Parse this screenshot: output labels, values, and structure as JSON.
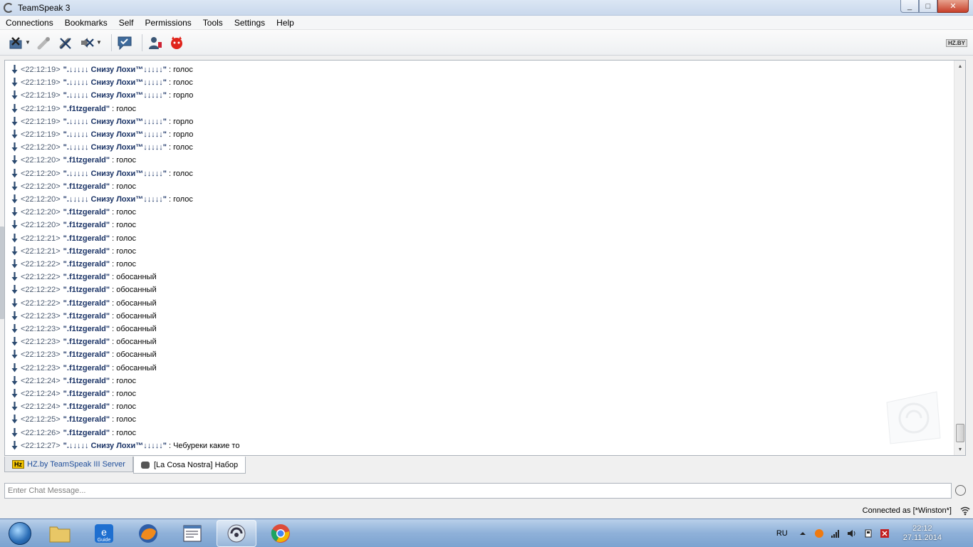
{
  "window": {
    "title": "TeamSpeak 3",
    "min": "_",
    "max": "□",
    "close": "✕"
  },
  "menu": [
    "Connections",
    "Bookmarks",
    "Self",
    "Permissions",
    "Tools",
    "Settings",
    "Help"
  ],
  "toolbar": {
    "logo_text": "HZ.BY"
  },
  "messages": [
    {
      "time": "<22:12:19>",
      "nick": "\".↓↓↓↓↓ Снизу Лохи™↓↓↓↓↓\"",
      "text": ": голос"
    },
    {
      "time": "<22:12:19>",
      "nick": "\".↓↓↓↓↓ Снизу Лохи™↓↓↓↓↓\"",
      "text": ": голос"
    },
    {
      "time": "<22:12:19>",
      "nick": "\".↓↓↓↓↓ Снизу Лохи™↓↓↓↓↓\"",
      "text": ": горло"
    },
    {
      "time": "<22:12:19>",
      "nick": "\".f1tzgerald\"",
      "text": ": голос"
    },
    {
      "time": "<22:12:19>",
      "nick": "\".↓↓↓↓↓ Снизу Лохи™↓↓↓↓↓\"",
      "text": ": горло"
    },
    {
      "time": "<22:12:19>",
      "nick": "\".↓↓↓↓↓ Снизу Лохи™↓↓↓↓↓\"",
      "text": ": горло"
    },
    {
      "time": "<22:12:20>",
      "nick": "\".↓↓↓↓↓ Снизу Лохи™↓↓↓↓↓\"",
      "text": ": голос"
    },
    {
      "time": "<22:12:20>",
      "nick": "\".f1tzgerald\"",
      "text": ": голос"
    },
    {
      "time": "<22:12:20>",
      "nick": "\".↓↓↓↓↓ Снизу Лохи™↓↓↓↓↓\"",
      "text": ": голос"
    },
    {
      "time": "<22:12:20>",
      "nick": "\".f1tzgerald\"",
      "text": ": голос"
    },
    {
      "time": "<22:12:20>",
      "nick": "\".↓↓↓↓↓ Снизу Лохи™↓↓↓↓↓\"",
      "text": ": голос"
    },
    {
      "time": "<22:12:20>",
      "nick": "\".f1tzgerald\"",
      "text": ": голос"
    },
    {
      "time": "<22:12:20>",
      "nick": "\".f1tzgerald\"",
      "text": ": голос"
    },
    {
      "time": "<22:12:21>",
      "nick": "\".f1tzgerald\"",
      "text": ": голос"
    },
    {
      "time": "<22:12:21>",
      "nick": "\".f1tzgerald\"",
      "text": ": голос"
    },
    {
      "time": "<22:12:22>",
      "nick": "\".f1tzgerald\"",
      "text": ": голос"
    },
    {
      "time": "<22:12:22>",
      "nick": "\".f1tzgerald\"",
      "text": ": обосанный"
    },
    {
      "time": "<22:12:22>",
      "nick": "\".f1tzgerald\"",
      "text": ": обосанный"
    },
    {
      "time": "<22:12:22>",
      "nick": "\".f1tzgerald\"",
      "text": ": обосанный"
    },
    {
      "time": "<22:12:23>",
      "nick": "\".f1tzgerald\"",
      "text": ": обосанный"
    },
    {
      "time": "<22:12:23>",
      "nick": "\".f1tzgerald\"",
      "text": ": обосанный"
    },
    {
      "time": "<22:12:23>",
      "nick": "\".f1tzgerald\"",
      "text": ": обосанный"
    },
    {
      "time": "<22:12:23>",
      "nick": "\".f1tzgerald\"",
      "text": ": обосанный"
    },
    {
      "time": "<22:12:23>",
      "nick": "\".f1tzgerald\"",
      "text": ": обосанный"
    },
    {
      "time": "<22:12:24>",
      "nick": "\".f1tzgerald\"",
      "text": ": голос"
    },
    {
      "time": "<22:12:24>",
      "nick": "\".f1tzgerald\"",
      "text": ": голос"
    },
    {
      "time": "<22:12:24>",
      "nick": "\".f1tzgerald\"",
      "text": ": голос"
    },
    {
      "time": "<22:12:25>",
      "nick": "\".f1tzgerald\"",
      "text": ": голос"
    },
    {
      "time": "<22:12:26>",
      "nick": "\".f1tzgerald\"",
      "text": ": голос"
    },
    {
      "time": "<22:12:27>",
      "nick": "\".↓↓↓↓↓ Снизу Лохи™↓↓↓↓↓\"",
      "text": ": Чебуреки какие то"
    }
  ],
  "tabs": [
    {
      "badge": "Hz",
      "label": "HZ.by TeamSpeak III Server"
    },
    {
      "label": "[La Cosa Nostra] Набор"
    }
  ],
  "chat_input": {
    "placeholder": "Enter Chat Message..."
  },
  "status": {
    "connected": "Connected as [*Winston*]"
  },
  "taskbar": {
    "lang": "RU",
    "time": "22:12",
    "date": "27.11.2014",
    "guide_label": "Guide"
  },
  "colors": {
    "nick": "#1a3366",
    "time": "#4b5a70",
    "accent": "#1f4e9a"
  }
}
